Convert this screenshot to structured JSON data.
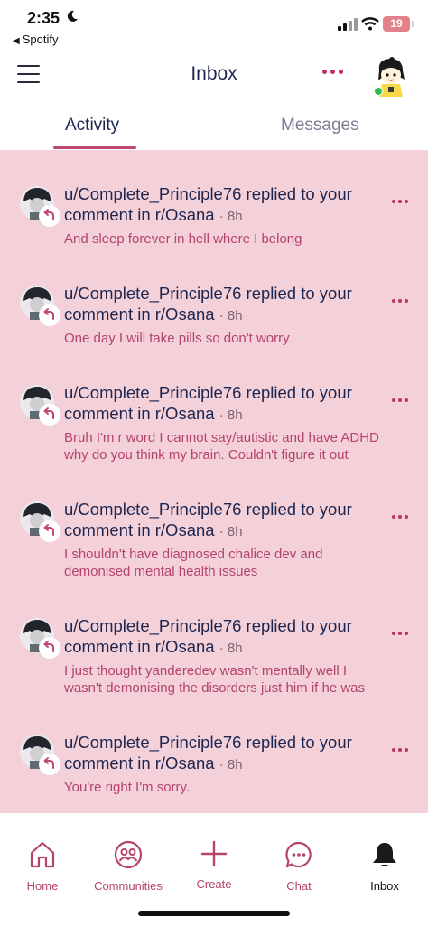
{
  "status": {
    "time": "2:35",
    "back_app": "Spotify",
    "battery": "19"
  },
  "header": {
    "title": "Inbox"
  },
  "tabs": [
    {
      "label": "Activity",
      "active": true
    },
    {
      "label": "Messages",
      "active": false
    }
  ],
  "notifications": [
    {
      "title": "u/Complete_Principle76 replied to your comment in r/Osana",
      "time": "· 8h",
      "body": "And sleep forever in hell where I belong"
    },
    {
      "title": "u/Complete_Principle76 replied to your comment in r/Osana",
      "time": "· 8h",
      "body": "One day I will take pills so don't worry"
    },
    {
      "title": "u/Complete_Principle76 replied to your comment in r/Osana",
      "time": "· 8h",
      "body": "Bruh I'm r word I cannot say/autistic and have ADHD why do you think my brain. Couldn't figure it out"
    },
    {
      "title": "u/Complete_Principle76 replied to your comment in r/Osana",
      "time": "· 8h",
      "body": "I shouldn't have diagnosed chalice dev and demonised mental health issues"
    },
    {
      "title": "u/Complete_Principle76 replied to your comment in r/Osana",
      "time": "· 8h",
      "body": "I just thought yanderedev wasn't mentally well I wasn't demonising the disorders just him if he was"
    },
    {
      "title": "u/Complete_Principle76 replied to your comment in r/Osana",
      "time": "· 8h",
      "body": "You're right I'm sorry."
    }
  ],
  "bottom_nav": [
    {
      "label": "Home",
      "icon": "home-icon"
    },
    {
      "label": "Communities",
      "icon": "communities-icon"
    },
    {
      "label": "Create",
      "icon": "plus-icon"
    },
    {
      "label": "Chat",
      "icon": "chat-icon"
    },
    {
      "label": "Inbox",
      "icon": "bell-icon",
      "active": true
    }
  ],
  "colors": {
    "accent": "#c14771",
    "list_bg": "#f4d0d8",
    "title_text": "#1d2651",
    "body_text": "#b4436f"
  }
}
